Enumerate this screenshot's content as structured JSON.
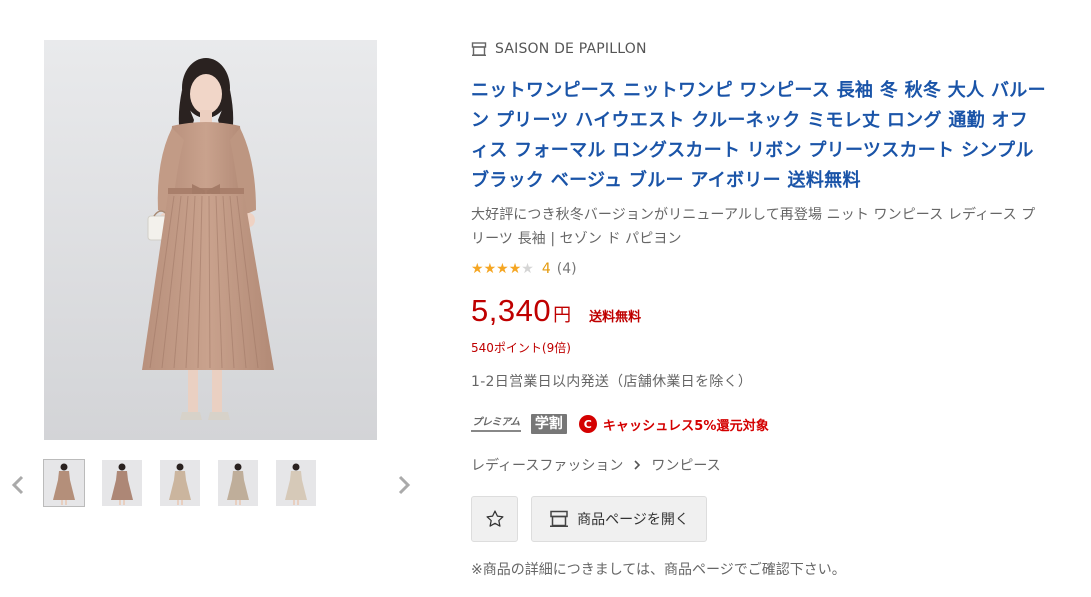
{
  "gallery": {
    "main_image_alt": "",
    "thumbnails": [
      {
        "tone": "#b48f7a",
        "active": true
      },
      {
        "tone": "#ad8776",
        "active": false
      },
      {
        "tone": "#cbb59e",
        "active": false
      },
      {
        "tone": "#bfae9a",
        "active": false
      },
      {
        "tone": "#d6c9b8",
        "active": false
      }
    ]
  },
  "store": {
    "name": "SAISON DE PAPILLON",
    "icon": "store-icon"
  },
  "product": {
    "title": "ニットワンピース ニットワンピ ワンピース 長袖 冬 秋冬 大人 バルーン プリーツ ハイウエスト クルーネック ミモレ丈 ロング 通勤 オフィス フォーマル ロングスカート リボン プリーツスカート シンプル ブラック ベージュ ブルー アイボリー 送料無料",
    "description": "大好評につき秋冬バージョンがリニューアルして再登場 ニット ワンピース レディース プリーツ 長袖 | セゾン ド パピヨン",
    "rating": {
      "stars": 4,
      "max_stars": 5,
      "score": "4",
      "count": "(4)"
    },
    "price": {
      "amount": "5,340",
      "currency": "円",
      "shipping": "送料無料"
    },
    "points": "540ポイント(9倍)",
    "delivery": "1-2日営業日以内発送（店舗休業日を除く）",
    "badges": {
      "premium": "プレミアム",
      "gakuwari": "学割",
      "cashless_icon_letter": "C",
      "cashless": "キャッシュレス5%還元対象"
    }
  },
  "breadcrumb": {
    "items": [
      "レディースファッション",
      "ワンピース"
    ]
  },
  "actions": {
    "favorite_icon": "star-outline-icon",
    "open_page": "商品ページを開く"
  },
  "note": "※商品の詳細につきましては、商品ページでご確認下さい。",
  "colors": {
    "title": "#1a54a8",
    "price": "#bf0000",
    "star": "#f5a623",
    "dress": "#c49b86"
  }
}
